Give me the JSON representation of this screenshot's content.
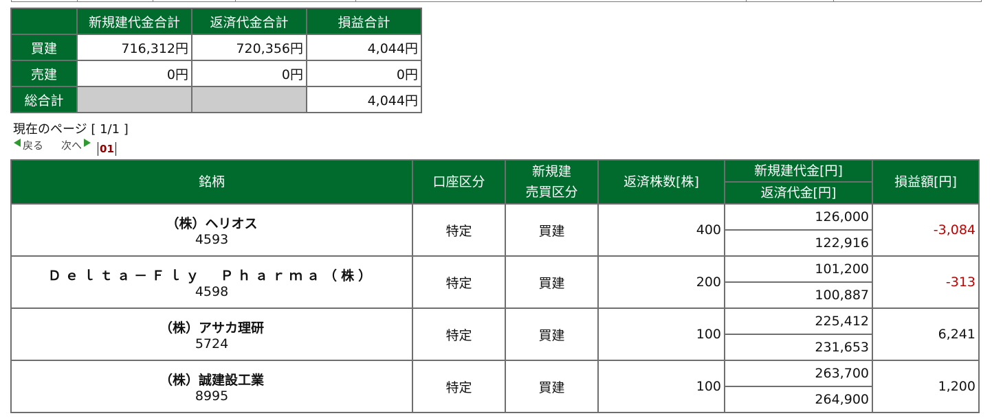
{
  "summary": {
    "headers": [
      "新規建代金合計",
      "返済代金合計",
      "損益合計"
    ],
    "rows": [
      {
        "label": "買建",
        "new_total": "716,312円",
        "close_total": "720,356円",
        "pl_total": "4,044円"
      },
      {
        "label": "売建",
        "new_total": "0円",
        "close_total": "0円",
        "pl_total": "0円"
      },
      {
        "label": "総合計",
        "pl_total": "4,044円"
      }
    ]
  },
  "pagination": {
    "current_page_text": "現在のページ [ 1/1 ]",
    "prev_label": "戻る",
    "next_label": "次へ",
    "page_number": "01"
  },
  "holdings": {
    "headers": {
      "issue": "銘柄",
      "account_type": "口座区分",
      "trade_type_line1": "新規建",
      "trade_type_line2": "売買区分",
      "quantity": "返済株数[株]",
      "new_amount": "新規建代金[円]",
      "close_amount": "返済代金[円]",
      "pl": "損益額[円]"
    },
    "rows": [
      {
        "name": "（株）ヘリオス",
        "code": "4593",
        "account": "特定",
        "trade": "買建",
        "qty": "400",
        "new_amount": "126,000",
        "close_amount": "122,916",
        "pl": "-3,084",
        "pl_negative": true
      },
      {
        "name": "Ｄｅｌｔａ－Ｆｌｙ　Ｐｈａｒｍａ（株）",
        "code": "4598",
        "account": "特定",
        "trade": "買建",
        "qty": "200",
        "new_amount": "101,200",
        "close_amount": "100,887",
        "pl": "-313",
        "pl_negative": true
      },
      {
        "name": "（株）アサカ理研",
        "code": "5724",
        "account": "特定",
        "trade": "買建",
        "qty": "100",
        "new_amount": "225,412",
        "close_amount": "231,653",
        "pl": "6,241",
        "pl_negative": false
      },
      {
        "name": "（株）誠建設工業",
        "code": "8995",
        "account": "特定",
        "trade": "買建",
        "qty": "100",
        "new_amount": "263,700",
        "close_amount": "264,900",
        "pl": "1,200",
        "pl_negative": false
      }
    ]
  },
  "colors": {
    "header_green": "#006b2d",
    "negative_red": "#c00000",
    "grid_gray": "#6e6e6e",
    "empty_cell_gray": "#cccccc"
  }
}
